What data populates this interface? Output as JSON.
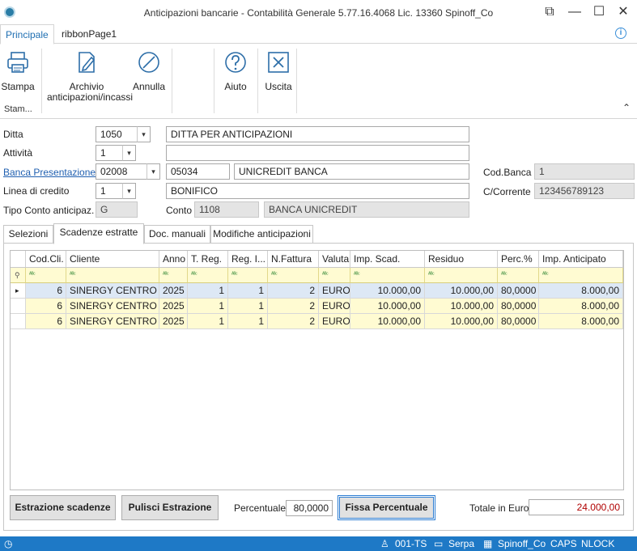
{
  "window": {
    "title": "Anticipazioni bancarie - Contabilità Generale 5.77.16.4068 Lic. 13360 Spinoff_Co",
    "controls": [
      "⧉",
      "—",
      "☐",
      "✕"
    ]
  },
  "ribbon": {
    "tabs": [
      "Principale",
      "ribbonPage1"
    ],
    "info_icon": "i",
    "buttons": {
      "stampa": "Stampa",
      "archivio_line1": "Archivio",
      "archivio_line2": "anticipazioni/incassi",
      "annulla": "Annulla",
      "aiuto": "Aiuto",
      "uscita": "Uscita"
    },
    "group_label": "Stam...",
    "collapse_glyph": "⌃"
  },
  "form": {
    "ditta_label": "Ditta",
    "ditta_code": "1050",
    "ditta_name": "DITTA PER ANTICIPAZIONI",
    "attivita_label": "Attività",
    "attivita_value": "1",
    "attivita_desc": "",
    "banca_label": "Banca Presentazione",
    "banca_code": "02008",
    "banca_cab": "05034",
    "banca_name": "UNICREDIT BANCA",
    "codbanca_label": "Cod.Banca",
    "codbanca_value": "1",
    "linea_label": "Linea di credito",
    "linea_value": "1",
    "linea_desc": "BONIFICO",
    "ccorrente_label": "C/Corrente",
    "ccorrente_value": "123456789123",
    "tipo_label": "Tipo Conto anticipaz.",
    "tipo_value": "G",
    "conto_label": "Conto",
    "conto_value": "1108",
    "conto_desc": "BANCA UNICREDIT",
    "dropdown_glyph": "▾"
  },
  "tabs": [
    "Selezioni",
    "Scadenze estratte",
    "Doc. manuali",
    "Modifiche anticipazioni"
  ],
  "grid": {
    "columns": [
      "Cod.Cli.",
      "Cliente",
      "Anno",
      "T. Reg.",
      "Reg. I...",
      "N.Fattura",
      "Valuta",
      "Imp. Scad.",
      "Residuo",
      "Perc.%",
      "Imp. Anticipato"
    ],
    "filter_glyph": "ᴬᴮᶜ",
    "filter_pin": "⚲",
    "row_indicator": "▸",
    "rows": [
      [
        "6",
        "SINERGY CENTRO S...",
        "2025",
        "1",
        "1",
        "2",
        "EURO",
        "10.000,00",
        "10.000,00",
        "80,0000",
        "8.000,00"
      ],
      [
        "6",
        "SINERGY CENTRO S...",
        "2025",
        "1",
        "1",
        "2",
        "EURO",
        "10.000,00",
        "10.000,00",
        "80,0000",
        "8.000,00"
      ],
      [
        "6",
        "SINERGY CENTRO S...",
        "2025",
        "1",
        "1",
        "2",
        "EURO",
        "10.000,00",
        "10.000,00",
        "80,0000",
        "8.000,00"
      ]
    ]
  },
  "footer": {
    "estrazione_button": "Estrazione scadenze",
    "pulisci_button": "Pulisci Estrazione",
    "percentuale_label": "Percentuale",
    "percentuale_value": "80,0000",
    "fissa_button": "Fissa Percentuale",
    "totale_label": "Totale in Euro",
    "totale_value": "24.000,00",
    "totale_color": "#b00000"
  },
  "statusbar": {
    "left_icon": "◷",
    "user": "001-TS",
    "host": "Serpa",
    "company": "Spinoff_Co",
    "caps": "CAPS",
    "nlock": "NLOCK"
  }
}
